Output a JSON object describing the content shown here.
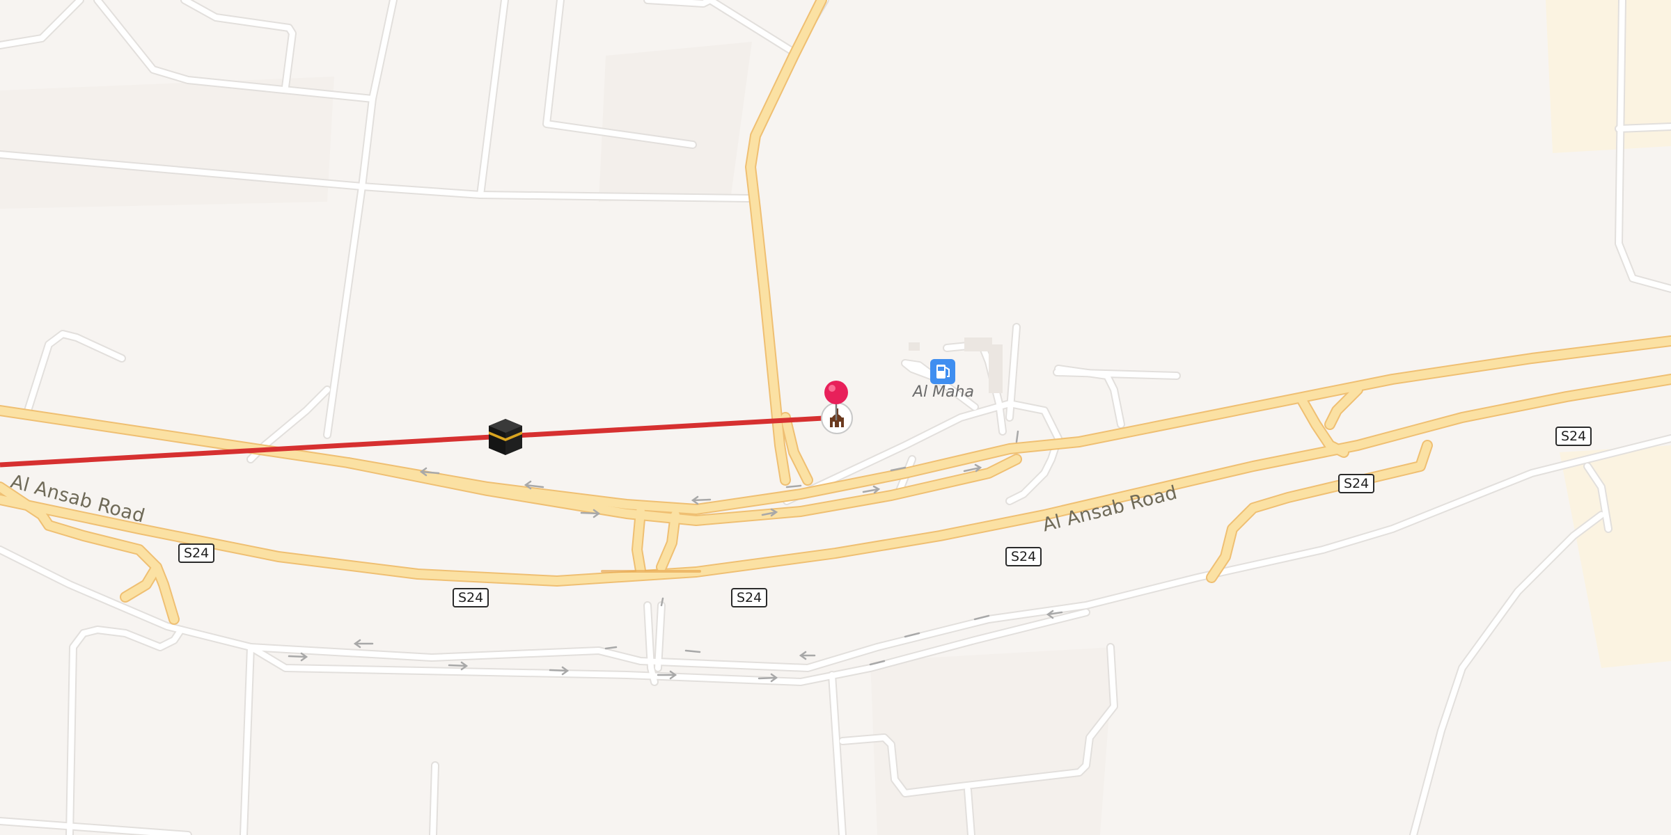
{
  "map": {
    "road_name_1": "Al Ansab Road",
    "road_name_2": "Al Ansab Road",
    "route_shields": [
      "S24",
      "S24",
      "S24",
      "S24",
      "S24",
      "S24"
    ],
    "poi": {
      "name": "Al Maha",
      "icon": "fuel-station-icon"
    },
    "markers": [
      {
        "icon": "kaaba-icon"
      },
      {
        "icon": "location-pin-icon"
      },
      {
        "icon": "mosque-icon"
      }
    ],
    "colors": {
      "background": "#f7f4f1",
      "minor_road": "#ffffff",
      "major_road_fill": "#fbe1a3",
      "major_road_casing": "#efbf72",
      "qibla_line": "#d63030",
      "pin": "#e8205a",
      "fuel_icon": "#3f8ef0"
    }
  }
}
